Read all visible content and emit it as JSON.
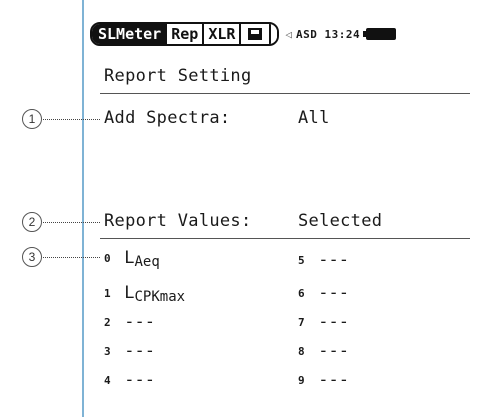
{
  "status_bar": {
    "tabs": [
      "SLMeter",
      "Rep",
      "XLR"
    ],
    "active_tab": "SLMeter",
    "save_icon": "disk-icon",
    "speaker_icon": "speaker-icon",
    "status_text": "ASD 13:24"
  },
  "page": {
    "title": "Report Setting"
  },
  "settings": {
    "add_spectra_label": "Add Spectra:",
    "add_spectra_value": "All",
    "report_values_label": "Report Values:",
    "report_values_value": "Selected"
  },
  "report_values": {
    "left": [
      {
        "index": "0",
        "main": "L",
        "sub": "Aeq"
      },
      {
        "index": "1",
        "main": "L",
        "sub": "CPKmax"
      },
      {
        "index": "2",
        "main": "---",
        "sub": ""
      },
      {
        "index": "3",
        "main": "---",
        "sub": ""
      },
      {
        "index": "4",
        "main": "---",
        "sub": ""
      }
    ],
    "right": [
      {
        "index": "5",
        "main": "---"
      },
      {
        "index": "6",
        "main": "---"
      },
      {
        "index": "7",
        "main": "---"
      },
      {
        "index": "8",
        "main": "---"
      },
      {
        "index": "9",
        "main": "---"
      }
    ]
  },
  "callouts": [
    "1",
    "2",
    "3"
  ]
}
